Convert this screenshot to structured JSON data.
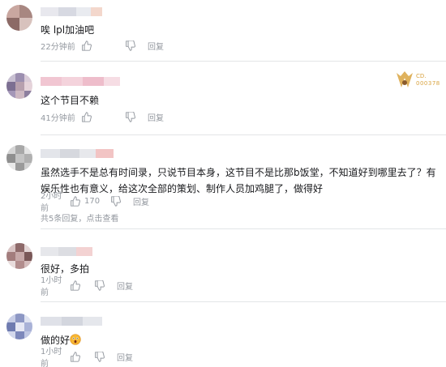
{
  "comments": [
    {
      "text": "唉 lpl加油吧",
      "time": "22分钟前",
      "like_count": "",
      "reply_label": "回复"
    },
    {
      "text": "这个节目不赖",
      "time": "41分钟前",
      "like_count": "",
      "reply_label": "回复"
    },
    {
      "text": "虽然选手不是总有时间录，只说节目本身，这节目不是比那b饭堂，不知道好到哪里去了？有娱乐性也有意义，给这次全部的策划、制作人员加鸡腿了，做得好",
      "time": "2小时前",
      "like_count": "170",
      "reply_label": "回复",
      "replies_count_text": "共5条回复，",
      "replies_link": "点击查看"
    },
    {
      "text": "很好，多拍",
      "time": "1小时前",
      "like_count": "",
      "reply_label": "回复"
    },
    {
      "text": "做的好",
      "time": "1小时前",
      "like_count": "",
      "reply_label": "回复"
    }
  ],
  "badge": {
    "label": "CD.",
    "number": "000378"
  },
  "colors": {
    "text": "#18191c",
    "meta": "#9499a0",
    "divider": "#e3e5e7",
    "badge_gold": "#d9a441"
  }
}
